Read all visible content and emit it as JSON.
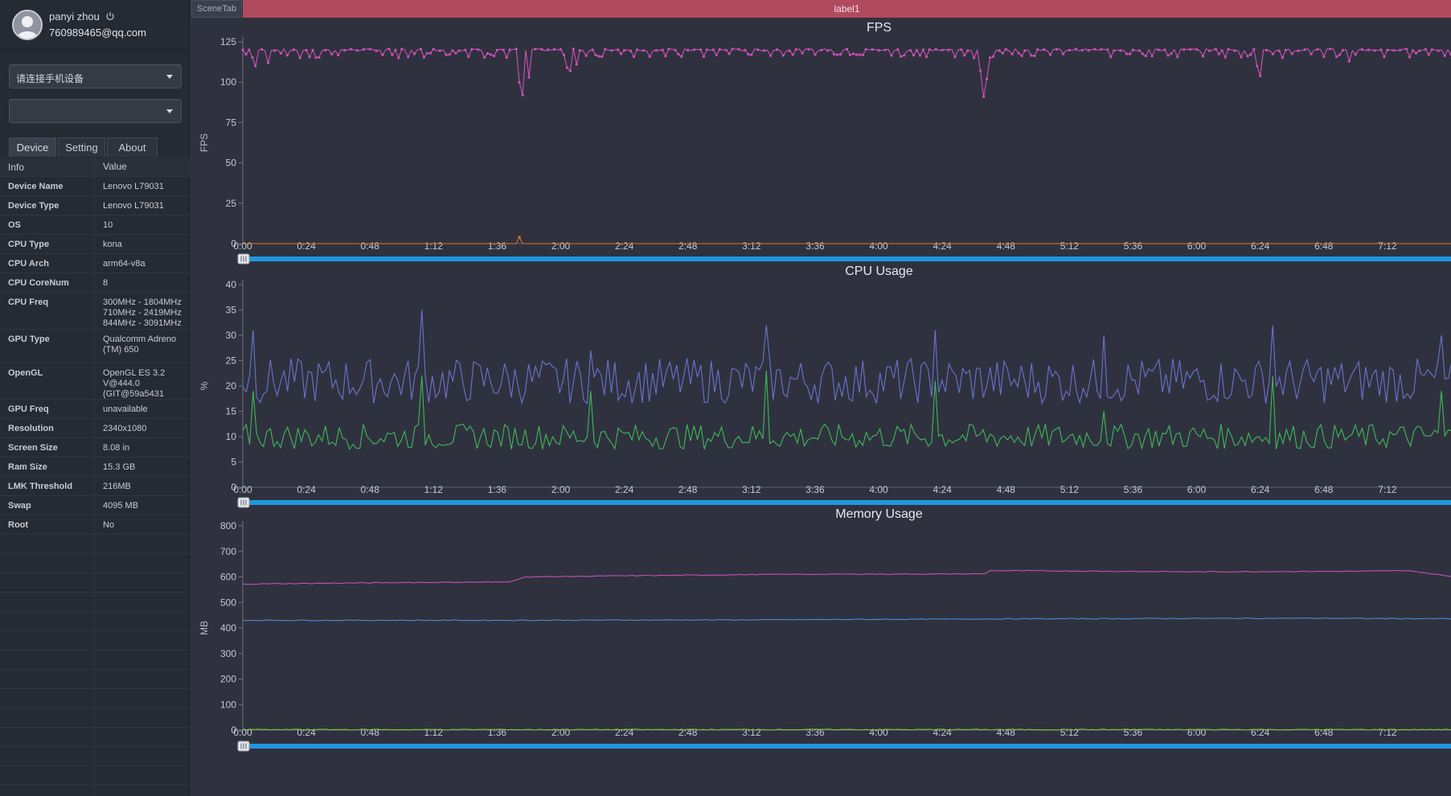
{
  "user": {
    "name": "panyi zhou",
    "email": "760989465@qq.com"
  },
  "device_select": {
    "value": "请连接手机设备"
  },
  "app_select": {
    "value": ""
  },
  "tabs": {
    "device": "Device",
    "setting": "Setting",
    "about": "About"
  },
  "info_table": {
    "headers": [
      "Info",
      "Value"
    ],
    "rows": [
      {
        "key": "Device Name",
        "value": "Lenovo L79031"
      },
      {
        "key": "Device Type",
        "value": "Lenovo L79031"
      },
      {
        "key": "OS",
        "value": "10"
      },
      {
        "key": "CPU Type",
        "value": "kona"
      },
      {
        "key": "CPU Arch",
        "value": "arm64-v8a"
      },
      {
        "key": "CPU CoreNum",
        "value": "8"
      },
      {
        "key": "CPU Freq",
        "value": "300MHz - 1804MHz\n710MHz - 2419MHz\n844MHz - 3091MHz"
      },
      {
        "key": "GPU Type",
        "value": "Qualcomm Adreno\n(TM) 650"
      },
      {
        "key": "OpenGL",
        "value": "OpenGL ES 3.2\nV@444.0\n(GIT@59a5431"
      },
      {
        "key": "GPU Freq",
        "value": "unavailable"
      },
      {
        "key": "Resolution",
        "value": "2340x1080"
      },
      {
        "key": "Screen Size",
        "value": "8.08 in"
      },
      {
        "key": "Ram Size",
        "value": "15.3 GB"
      },
      {
        "key": "LMK Threshold",
        "value": "216MB"
      },
      {
        "key": "Swap",
        "value": "4095 MB"
      },
      {
        "key": "Root",
        "value": "No"
      }
    ]
  },
  "top_tabs": {
    "scene_tab": "SceneTab",
    "active_tab": "label1"
  },
  "colors": {
    "fps": "#cf4fb8",
    "jank": "#e0732e",
    "cpu_total": "#6c72cf",
    "cpu_app": "#3fb85a",
    "mem_total": "#c64fb4",
    "mem_app": "#4c8ad6",
    "mem_other": "#7fc23a",
    "slider": "#1f96e0"
  },
  "x_ticks": [
    "0:00",
    "0:24",
    "0:48",
    "1:12",
    "1:36",
    "2:00",
    "2:24",
    "2:48",
    "3:12",
    "3:36",
    "4:00",
    "4:24",
    "4:48",
    "5:12",
    "5:36",
    "6:00",
    "6:24",
    "6:48",
    "7:12"
  ],
  "chart_data": [
    {
      "type": "line",
      "title": "FPS",
      "ylabel": "FPS",
      "yticks": [
        0,
        25,
        50,
        75,
        100,
        125
      ],
      "ylim": [
        0,
        125
      ],
      "xlim_seconds": [
        0,
        457
      ],
      "series": [
        {
          "color_key": "fps",
          "markers": true,
          "baseline": 120,
          "dips": [
            [
              5,
              110
            ],
            [
              10,
              112
            ],
            [
              104,
              100
            ],
            [
              106,
              92
            ],
            [
              108,
              103
            ],
            [
              122,
              109
            ],
            [
              124,
              107
            ],
            [
              126,
              111
            ],
            [
              278,
              107
            ],
            [
              279,
              91
            ],
            [
              281,
              102
            ],
            [
              383,
              110
            ],
            [
              384,
              104
            ],
            [
              418,
              113
            ],
            [
              478,
              111
            ]
          ]
        },
        {
          "color_key": "jank",
          "markers": true,
          "baseline": 0,
          "spikes": [
            [
              104,
              4
            ]
          ]
        }
      ]
    },
    {
      "type": "line",
      "title": "CPU Usage",
      "ylabel": "%",
      "yticks": [
        0,
        5,
        10,
        15,
        20,
        25,
        30,
        35,
        40
      ],
      "ylim": [
        0,
        40
      ],
      "xlim_seconds": [
        0,
        457
      ],
      "series": [
        {
          "color_key": "cpu_total",
          "baseline": 21,
          "spikes": [
            [
              4,
              31
            ],
            [
              68,
              35
            ],
            [
              131,
              27
            ],
            [
              197,
              32
            ],
            [
              261,
              31
            ],
            [
              325,
              30
            ],
            [
              389,
              32
            ],
            [
              453,
              30
            ]
          ]
        },
        {
          "color_key": "cpu_app",
          "baseline": 10,
          "spikes": [
            [
              4,
              19
            ],
            [
              68,
              22
            ],
            [
              131,
              19
            ],
            [
              197,
              23
            ],
            [
              261,
              21
            ],
            [
              325,
              15
            ],
            [
              389,
              22
            ],
            [
              453,
              19
            ]
          ]
        }
      ]
    },
    {
      "type": "line",
      "title": "Memory Usage",
      "ylabel": "MB",
      "yticks": [
        0,
        100,
        200,
        300,
        400,
        500,
        600,
        700,
        800
      ],
      "ylim": [
        0,
        800
      ],
      "xlim_seconds": [
        0,
        457
      ],
      "series": [
        {
          "color_key": "mem_total",
          "points": [
            [
              0,
              572
            ],
            [
              60,
              578
            ],
            [
              100,
              580
            ],
            [
              107,
              600
            ],
            [
              150,
              605
            ],
            [
              200,
              610
            ],
            [
              280,
              612
            ],
            [
              282,
              625
            ],
            [
              360,
              620
            ],
            [
              420,
              622
            ],
            [
              440,
              625
            ],
            [
              457,
              600
            ]
          ]
        },
        {
          "color_key": "mem_app",
          "points": [
            [
              0,
              430
            ],
            [
              100,
              430
            ],
            [
              200,
              432
            ],
            [
              300,
              436
            ],
            [
              400,
              438
            ],
            [
              457,
              436
            ]
          ]
        },
        {
          "color_key": "mem_other",
          "points": [
            [
              0,
              2
            ],
            [
              457,
              2
            ]
          ]
        }
      ]
    }
  ]
}
